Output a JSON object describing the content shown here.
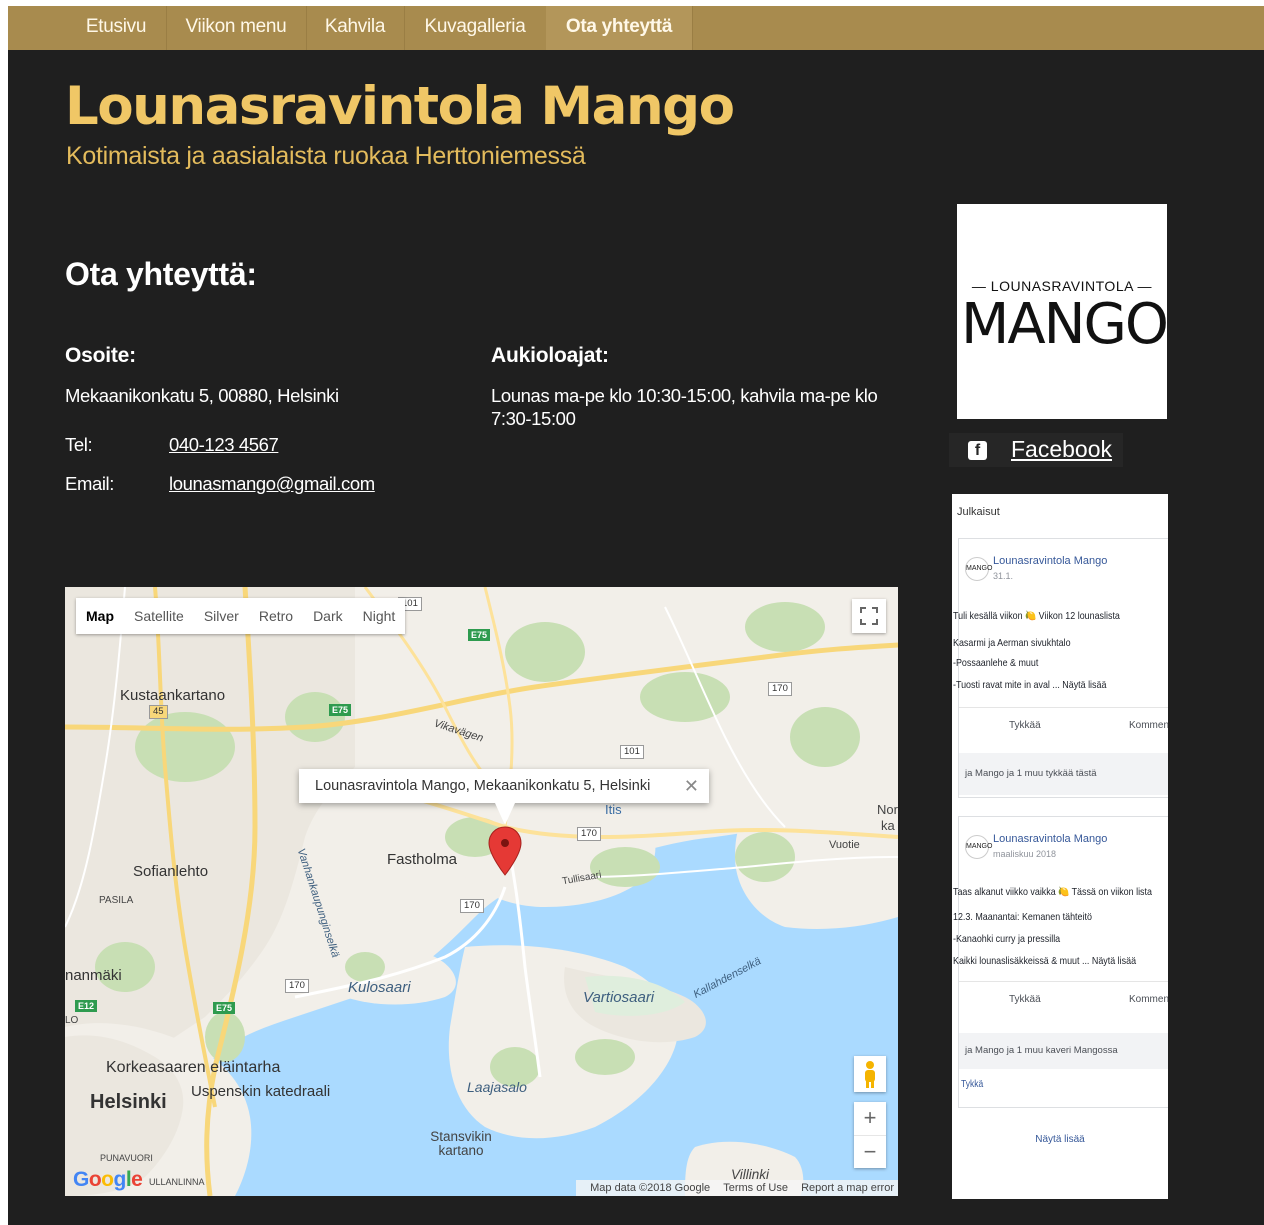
{
  "nav": {
    "items": [
      "Etusivu",
      "Viikon menu",
      "Kahvila",
      "Kuvagalleria",
      "Ota yhteyttä"
    ],
    "active_index": 4
  },
  "header": {
    "title": "Lounasravintola Mango",
    "subtitle": "Kotimaista ja aasialaista ruokaa Herttoniemessä"
  },
  "contact": {
    "heading": "Ota yhteyttä:",
    "address_heading": "Osoite:",
    "address": "Mekaanikonkatu 5, 00880, Helsinki",
    "tel_label": "Tel:",
    "tel": "040-123 4567",
    "email_label": "Email:",
    "email": "lounasmango@gmail.com",
    "hours_heading": "Aukioloajat:",
    "hours": "Lounas ma-pe klo 10:30-15:00, kahvila ma-pe klo 7:30-15:00"
  },
  "map": {
    "types": [
      "Map",
      "Satellite",
      "Silver",
      "Retro",
      "Dark",
      "Night"
    ],
    "active_type": "Map",
    "info_window": "Lounasravintola Mango, Mekaanikonkatu 5, Helsinki",
    "info_close": "✕",
    "zoom_in": "+",
    "zoom_out": "−",
    "logo": "Google",
    "attribution": {
      "data": "Map data ©2018 Google",
      "terms": "Terms of Use",
      "report": "Report a map error"
    },
    "labels": {
      "kustaankartano": "Kustaankartano",
      "viikinkaari": "Vikavägen",
      "fastholma": "Fastholma",
      "sofianlehto": "Sofianlehto",
      "pasila": "PASILA",
      "kulosaari": "Kulosaari",
      "vartiosaari": "Vartiosaari",
      "korkeasaari": "Korkeasaaren eläintarha",
      "uspenski": "Uspenskin katedraali",
      "helsinki": "Helsinki",
      "laajasalo": "Laajasalo",
      "stansvikin": "Stansvikin kartano",
      "punavuori": "PUNAVUORI",
      "ullanlinna": "ULLANLINNA",
      "villinki": "Villinki",
      "mannimaki": "nanmäki",
      "vuotie": "Vuotie",
      "tullisaari": "Tullisaari",
      "kallahdenselka": "Kallahdenselkä",
      "vanhankaupunginselka": "Vanhankaupunginselkä",
      "nor": "Nor",
      "ka": "ka",
      "lo": "LO",
      "itis": "Itis"
    },
    "road_badges": [
      "101",
      "170",
      "101",
      "170",
      "170",
      "170",
      "45"
    ],
    "euro_badges": [
      "E75",
      "E75",
      "E12",
      "E75"
    ]
  },
  "sidebar": {
    "logo_top": "— LOUNASRAVINTOLA —",
    "logo_main": "MANGO",
    "facebook": "Facebook",
    "fb_icon": "f",
    "widget": {
      "header": "Julkaisut",
      "posts": [
        {
          "author": "Lounasravintola Mango",
          "date": "31.1.",
          "lines": [
            "Tuli kesällä viikon 🍋 Viikon 12 lounaslista",
            "Kasarmi ja Aerman sivukhtalo",
            "-Possaanlehe & muut",
            "-Tuosti ravat mite in aval ... Näytä lisää"
          ],
          "like": "Tykkää",
          "comment": "Kommentoi",
          "footer": "ja Mango ja 1 muu tykkää tästä"
        },
        {
          "author": "Lounasravintola Mango",
          "date": "maaliskuu 2018",
          "lines": [
            "Taas alkanut viikko vaikka 🍋 Tässä on viikon lista",
            "12.3. Maanantai: Kemanen tähteitö",
            "-Kanaohki curry ja pressilla",
            "Kaikki lounaslisäkkeissä & muut ... Näytä lisää"
          ],
          "like": "Tykkää",
          "comment": "Kommentoi",
          "footer": "ja Mango ja 1 muu kaveri Mangossa",
          "extra": "Tykkä"
        }
      ],
      "more": "Näytä lisää"
    }
  },
  "colors": {
    "nav_bg": "#a88b4e",
    "page_bg": "#1f1f1f",
    "title": "#f0c766",
    "subtitle": "#e3bb5c"
  }
}
